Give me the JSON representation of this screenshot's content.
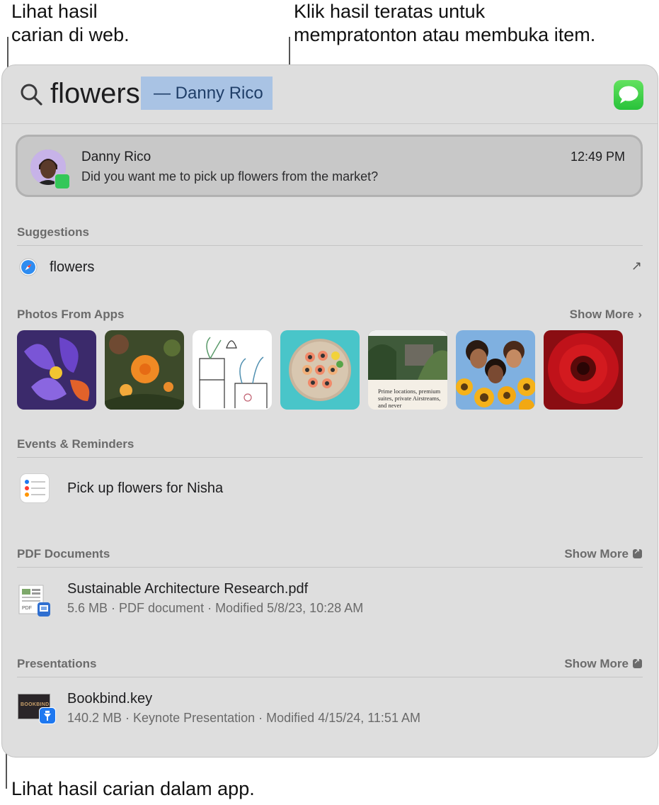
{
  "callouts": {
    "web_results": "Lihat hasil\ncarian di web.",
    "top_hit": "Klik hasil teratas untuk\nmempratonton atau membuka item.",
    "in_app": "Lihat hasil carian dalam app."
  },
  "search": {
    "query": "flowers",
    "completion": "— Danny Rico"
  },
  "top_hit": {
    "name": "Danny Rico",
    "time": "12:49 PM",
    "snippet": "Did you want me to pick up flowers from the market?"
  },
  "suggestions": {
    "title": "Suggestions",
    "item_label": "flowers"
  },
  "photos": {
    "title": "Photos From Apps",
    "show_more": "Show More",
    "items": [
      {
        "icon": "iris-flower-photo"
      },
      {
        "icon": "marigold-photo"
      },
      {
        "icon": "plant-sketch-photo"
      },
      {
        "icon": "sushi-plate-photo"
      },
      {
        "icon": "article-photo",
        "caption": "Prime locations, premium suites, private Airstreams, and never"
      },
      {
        "icon": "friends-sunflowers-photo"
      },
      {
        "icon": "red-gerbera-photo"
      }
    ]
  },
  "events": {
    "title": "Events & Reminders",
    "item_label": "Pick up flowers for Nisha"
  },
  "pdf": {
    "title": "PDF Documents",
    "show_more": "Show More",
    "file_name": "Sustainable Architecture Research.pdf",
    "file_meta": "5.6 MB · PDF document · Modified 5/8/23, 10:28 AM"
  },
  "presentations": {
    "title": "Presentations",
    "show_more": "Show More",
    "file_name": "Bookbind.key",
    "file_meta": "140.2 MB · Keynote Presentation · Modified 4/15/24, 11:51 AM",
    "thumb_text": "BOOKBIND"
  },
  "colors": {
    "panel_bg": "#dedede",
    "selection": "#a9c3e4",
    "messages_green": "#34c759",
    "keynote_blue": "#1e78f0"
  }
}
